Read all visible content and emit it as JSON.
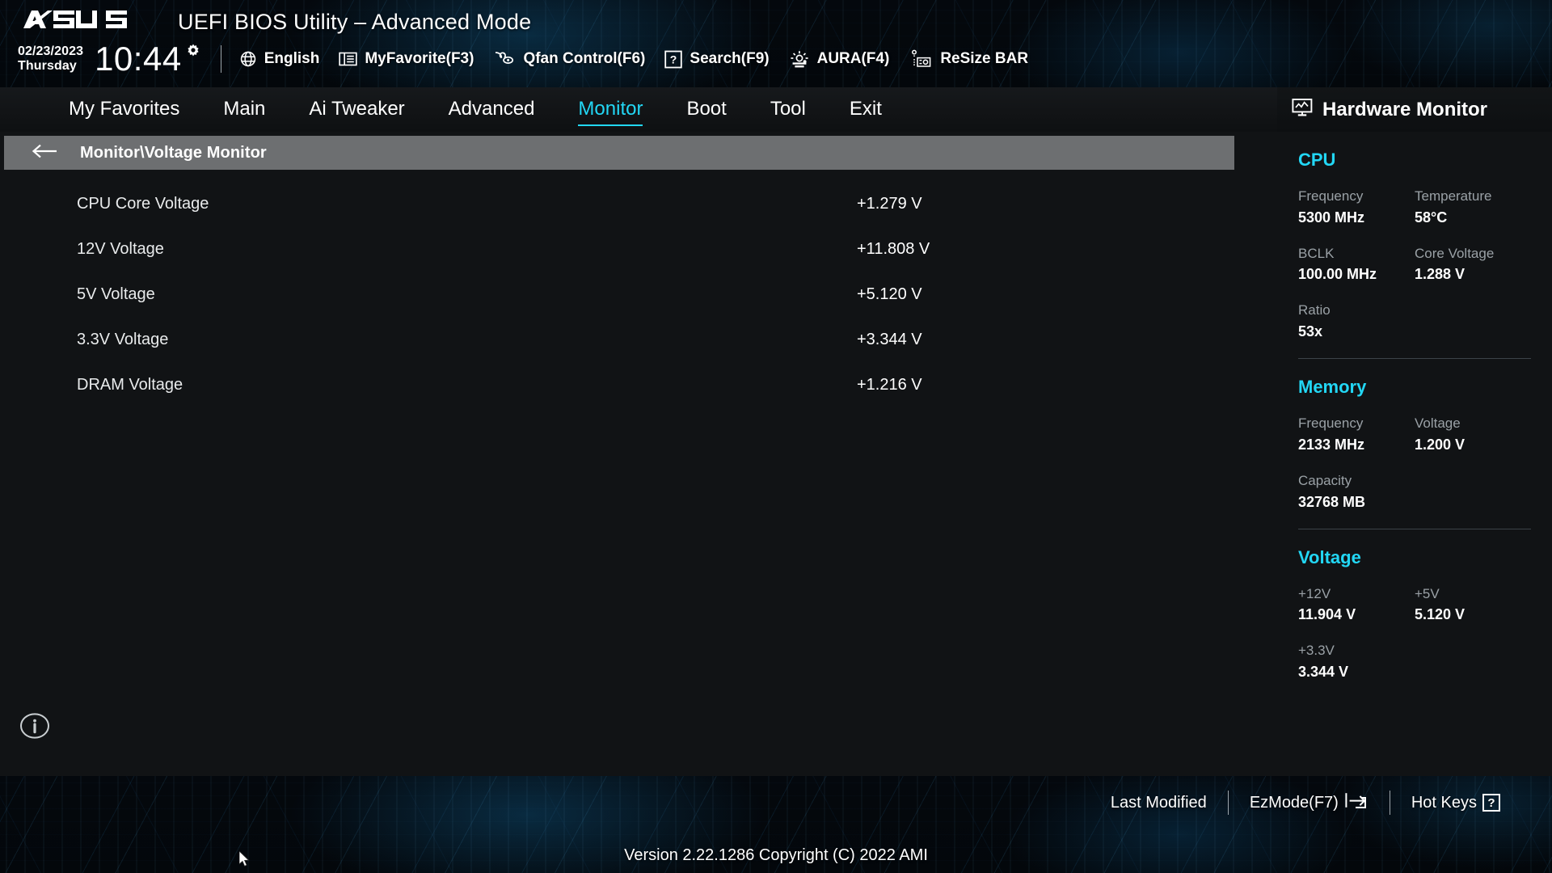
{
  "header": {
    "logo_text": "ASUS",
    "title": "UEFI BIOS Utility – Advanced Mode",
    "date": "02/23/2023",
    "weekday": "Thursday",
    "time": "10:44",
    "gear_icon": "gear-icon",
    "toolbar": [
      {
        "label": "English",
        "icon": "globe-icon"
      },
      {
        "label": "MyFavorite(F3)",
        "icon": "list-icon"
      },
      {
        "label": "Qfan Control(F6)",
        "icon": "fan-icon"
      },
      {
        "label": "Search(F9)",
        "icon": "question-box-icon"
      },
      {
        "label": "AURA(F4)",
        "icon": "aura-light-icon"
      },
      {
        "label": "ReSize BAR",
        "icon": "resize-bar-icon"
      }
    ]
  },
  "nav": {
    "tabs": [
      {
        "label": "My Favorites",
        "active": false
      },
      {
        "label": "Main",
        "active": false
      },
      {
        "label": "Ai Tweaker",
        "active": false
      },
      {
        "label": "Advanced",
        "active": false
      },
      {
        "label": "Monitor",
        "active": true
      },
      {
        "label": "Boot",
        "active": false
      },
      {
        "label": "Tool",
        "active": false
      },
      {
        "label": "Exit",
        "active": false
      }
    ]
  },
  "main": {
    "breadcrumb": "Monitor\\Voltage Monitor",
    "back_icon": "back-arrow-icon",
    "info_icon": "info-icon",
    "rows": [
      {
        "name": "CPU Core Voltage",
        "value": "+1.279 V"
      },
      {
        "name": "12V Voltage",
        "value": "+11.808 V"
      },
      {
        "name": "5V Voltage",
        "value": "+5.120 V"
      },
      {
        "name": "3.3V Voltage",
        "value": "+3.344 V"
      },
      {
        "name": "DRAM Voltage",
        "value": "+1.216 V"
      }
    ]
  },
  "sidebar": {
    "title": "Hardware Monitor",
    "title_icon": "monitor-icon",
    "sections": [
      {
        "title": "CPU",
        "pairs": [
          [
            {
              "label": "Frequency",
              "value": "5300 MHz"
            },
            {
              "label": "Temperature",
              "value": "58°C"
            }
          ],
          [
            {
              "label": "BCLK",
              "value": "100.00 MHz"
            },
            {
              "label": "Core Voltage",
              "value": "1.288 V"
            }
          ],
          [
            {
              "label": "Ratio",
              "value": "53x"
            }
          ]
        ]
      },
      {
        "title": "Memory",
        "pairs": [
          [
            {
              "label": "Frequency",
              "value": "2133 MHz"
            },
            {
              "label": "Voltage",
              "value": "1.200 V"
            }
          ],
          [
            {
              "label": "Capacity",
              "value": "32768 MB"
            }
          ]
        ]
      },
      {
        "title": "Voltage",
        "pairs": [
          [
            {
              "label": "+12V",
              "value": "11.904 V"
            },
            {
              "label": "+5V",
              "value": "5.120 V"
            }
          ],
          [
            {
              "label": "+3.3V",
              "value": "3.344 V"
            }
          ]
        ]
      }
    ]
  },
  "footer": {
    "last_modified": "Last Modified",
    "ezmode": "EzMode(F7)",
    "ezmode_icon": "exit-arrow-icon",
    "hotkeys": "Hot Keys",
    "hotkeys_icon": "question-box-icon",
    "version": "Version 2.22.1286 Copyright (C) 2022 AMI"
  },
  "colors": {
    "accent": "#22d7f5",
    "breadcrumb_bg": "#6d6f71",
    "content_bg": "#111315",
    "label_gray": "#9aa1a6"
  }
}
